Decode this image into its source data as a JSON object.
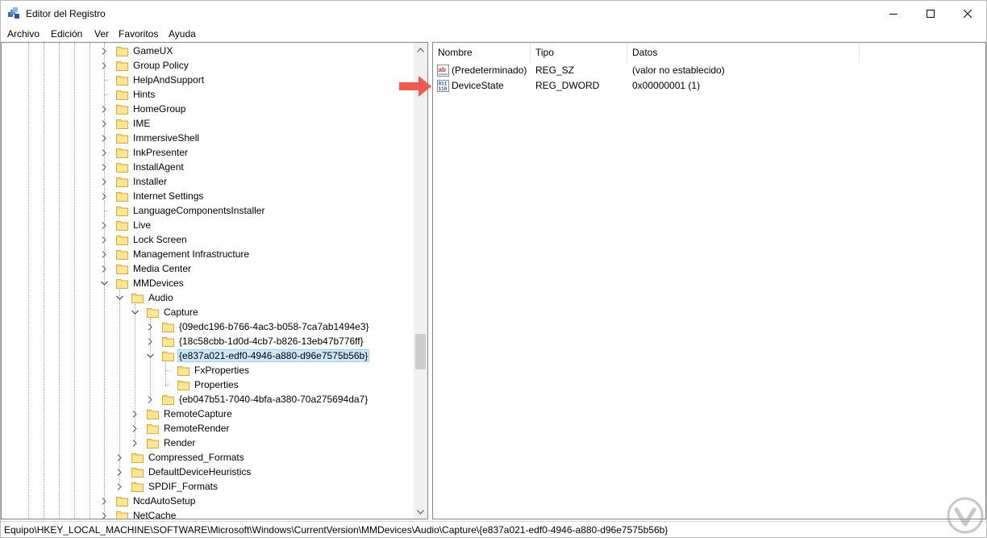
{
  "window": {
    "title": "Editor del Registro",
    "controls": {
      "minimize": "minimize-icon",
      "maximize": "maximize-icon",
      "close": "close-icon"
    }
  },
  "menu": [
    "Archivo",
    "Edición",
    "Ver",
    "Favoritos",
    "Ayuda"
  ],
  "tree": [
    {
      "label": "GameUX",
      "expander": "collapsed"
    },
    {
      "label": "Group Policy",
      "expander": "collapsed"
    },
    {
      "label": "HelpAndSupport",
      "expander": "none"
    },
    {
      "label": "Hints",
      "expander": "none"
    },
    {
      "label": "HomeGroup",
      "expander": "collapsed"
    },
    {
      "label": "IME",
      "expander": "collapsed"
    },
    {
      "label": "ImmersiveShell",
      "expander": "collapsed"
    },
    {
      "label": "InkPresenter",
      "expander": "collapsed"
    },
    {
      "label": "InstallAgent",
      "expander": "collapsed"
    },
    {
      "label": "Installer",
      "expander": "collapsed"
    },
    {
      "label": "Internet Settings",
      "expander": "collapsed"
    },
    {
      "label": "LanguageComponentsInstaller",
      "expander": "none"
    },
    {
      "label": "Live",
      "expander": "collapsed"
    },
    {
      "label": "Lock Screen",
      "expander": "collapsed"
    },
    {
      "label": "Management Infrastructure",
      "expander": "collapsed"
    },
    {
      "label": "Media Center",
      "expander": "collapsed"
    },
    {
      "label": "MMDevices",
      "expander": "expanded"
    },
    {
      "label": "Audio",
      "expander": "expanded"
    },
    {
      "label": "Capture",
      "expander": "expanded"
    },
    {
      "label": "{09edc196-b766-4ac3-b058-7ca7ab1494e3}",
      "expander": "collapsed"
    },
    {
      "label": "{18c58cbb-1d0d-4cb7-b826-13eb47b776ff}",
      "expander": "collapsed"
    },
    {
      "label": "{e837a021-edf0-4946-a880-d96e7575b56b}",
      "expander": "expanded",
      "selected": true
    },
    {
      "label": "FxProperties",
      "expander": "none"
    },
    {
      "label": "Properties",
      "expander": "none"
    },
    {
      "label": "{eb047b51-7040-4bfa-a380-70a275694da7}",
      "expander": "collapsed"
    },
    {
      "label": "RemoteCapture",
      "expander": "collapsed"
    },
    {
      "label": "RemoteRender",
      "expander": "collapsed"
    },
    {
      "label": "Render",
      "expander": "collapsed"
    },
    {
      "label": "Compressed_Formats",
      "expander": "collapsed"
    },
    {
      "label": "DefaultDeviceHeuristics",
      "expander": "collapsed"
    },
    {
      "label": "SPDIF_Formats",
      "expander": "collapsed"
    },
    {
      "label": "NcdAutoSetup",
      "expander": "collapsed"
    },
    {
      "label": "NetCache",
      "expander": "collapsed"
    }
  ],
  "list": {
    "columns": [
      "Nombre",
      "Tipo",
      "Datos"
    ],
    "rows": [
      {
        "name": "(Predeterminado)",
        "type": "REG_SZ",
        "data": "(valor no establecido)",
        "icon": "string-value-icon"
      },
      {
        "name": "DeviceState",
        "type": "REG_DWORD",
        "data": "0x00000001 (1)",
        "icon": "dword-value-icon"
      }
    ]
  },
  "status": {
    "path": "Equipo\\HKEY_LOCAL_MACHINE\\SOFTWARE\\Microsoft\\Windows\\CurrentVersion\\MMDevices\\Audio\\Capture\\{e837a021-edf0-4946-a880-d96e7575b56b}"
  },
  "colors": {
    "selection": "#cce8ff",
    "folder": "#ffd86e",
    "annotation_arrow": "#f05a50"
  }
}
